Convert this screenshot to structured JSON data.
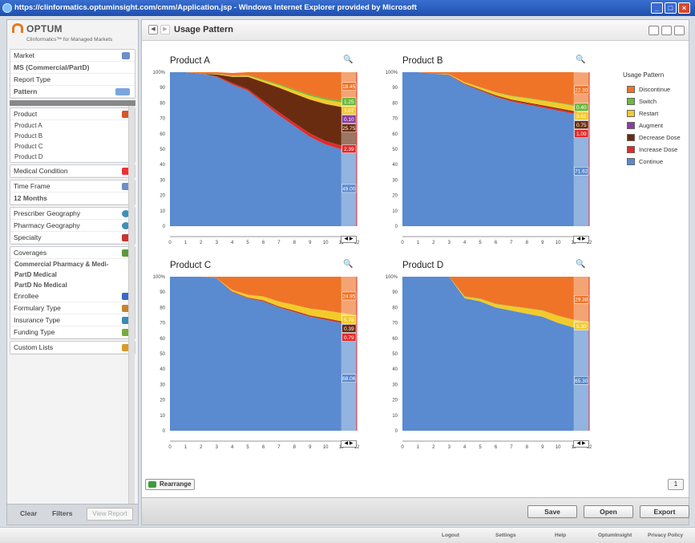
{
  "window": {
    "title": "https://clinformatics.optuminsight.com/cmm/Application.jsp - Windows Internet Explorer provided by Microsoft"
  },
  "brand": {
    "name": "OPTUM",
    "subtitle": "Clinformatics™ for Managed Markets"
  },
  "sidebar": {
    "market": {
      "label": "Market",
      "value": "MS (Commercial/PartD)"
    },
    "report_type": {
      "label": "Report Type",
      "value": "Pattern"
    },
    "product": {
      "label": "Product",
      "items": [
        "Product A",
        "Product B",
        "Product C",
        "Product D"
      ]
    },
    "medical_condition": "Medical Condition",
    "time_frame": {
      "label": "Time Frame",
      "value": "12 Months"
    },
    "prescriber_geography": "Prescriber Geography",
    "pharmacy_geography": "Pharmacy Geography",
    "specialty": "Specialty",
    "coverages": {
      "label": "Coverages",
      "items": [
        "Commercial Pharmacy & Medi-",
        "PartD Medical",
        "PartD No Medical"
      ]
    },
    "enrollee": "Enrollee",
    "formulary_type": "Formulary Type",
    "insurance_type": "Insurance Type",
    "funding_type": "Funding Type",
    "custom_lists": "Custom Lists",
    "buttons": {
      "clear": "Clear",
      "filters": "Filters",
      "view_report": "View Report"
    }
  },
  "main": {
    "title": "Usage Pattern",
    "rearrange": "Rearrange",
    "page": "1",
    "buttons": {
      "save": "Save",
      "open": "Open",
      "export": "Export"
    }
  },
  "legend": {
    "title": "Usage Pattern",
    "items": [
      "Discontinue",
      "Switch",
      "Restart",
      "Augment",
      "Decrease Dose",
      "Increase Dose",
      "Continue"
    ]
  },
  "colors": {
    "Discontinue": "#ef7428",
    "Switch": "#6cb93b",
    "Restart": "#f2cb2a",
    "Augment": "#8a3f9c",
    "Decrease Dose": "#6a2c10",
    "Increase Dose": "#e22a2a",
    "Continue": "#5a8acf"
  },
  "status": {
    "links": [
      "Logout",
      "Settings",
      "Help",
      "OptumInsight",
      "Privacy Policy"
    ]
  },
  "chart_data": [
    {
      "type": "area",
      "title": "Product A",
      "x": [
        0,
        1,
        2,
        3,
        4,
        5,
        6,
        7,
        8,
        9,
        10,
        11,
        12
      ],
      "x_ticks": [
        "0",
        "1",
        "2",
        "3",
        "4",
        "5",
        "6",
        "7",
        "8",
        "9",
        "10",
        "11",
        "12"
      ],
      "y_ticks": [
        "100%",
        "90",
        "80",
        "70",
        "60",
        "50",
        "40",
        "30",
        "20",
        "10",
        "0"
      ],
      "ylim": [
        0,
        100
      ],
      "series": [
        {
          "name": "Continue",
          "values": [
            100,
            100,
            99,
            97,
            92,
            88,
            80,
            72,
            65,
            58,
            53,
            50,
            49
          ]
        },
        {
          "name": "Increase Dose",
          "values": [
            0,
            0,
            0,
            0.5,
            1,
            1,
            1.5,
            2,
            2,
            2.2,
            2.3,
            2.4,
            2.39
          ]
        },
        {
          "name": "Decrease Dose",
          "values": [
            0,
            0,
            0,
            1,
            4,
            8,
            12,
            16,
            19,
            22,
            24,
            25,
            25.75
          ]
        },
        {
          "name": "Augment",
          "values": [
            0,
            0,
            0,
            0,
            0,
            0,
            0,
            0,
            0,
            0.05,
            0.1,
            0.1,
            0.1
          ]
        },
        {
          "name": "Restart",
          "values": [
            0,
            0,
            0,
            0.2,
            0.5,
            0.8,
            1.2,
            1.6,
            2,
            2.4,
            2.7,
            2.9,
            3.07
          ]
        },
        {
          "name": "Switch",
          "values": [
            0,
            0,
            0,
            0.2,
            0.3,
            0.4,
            0.5,
            0.7,
            0.8,
            0.9,
            1,
            1.1,
            1.25
          ]
        },
        {
          "name": "Discontinue",
          "values": [
            0,
            0,
            1,
            1.1,
            1.7,
            1.8,
            4.8,
            7.7,
            11.2,
            14.45,
            16.9,
            18.5,
            18.45
          ]
        }
      ],
      "end_labels": [
        "18.45",
        "1.25",
        "3.07",
        "0.10",
        "25.75",
        "2.39",
        "49.00"
      ]
    },
    {
      "type": "area",
      "title": "Product B",
      "x": [
        0,
        1,
        2,
        3,
        4,
        5,
        6,
        7,
        8,
        9,
        10,
        11,
        12
      ],
      "x_ticks": [
        "0",
        "1",
        "2",
        "3",
        "4",
        "5",
        "6",
        "7",
        "8",
        "9",
        "10",
        "11",
        "12"
      ],
      "y_ticks": [
        "100%",
        "90",
        "80",
        "70",
        "60",
        "50",
        "40",
        "30",
        "20",
        "10",
        "0"
      ],
      "ylim": [
        0,
        100
      ],
      "series": [
        {
          "name": "Continue",
          "values": [
            100,
            100,
            99,
            98,
            92,
            88,
            84,
            81,
            79,
            77,
            75,
            73,
            71.62
          ]
        },
        {
          "name": "Increase Dose",
          "values": [
            0,
            0,
            0,
            0.2,
            0.4,
            0.5,
            0.6,
            0.7,
            0.8,
            0.9,
            1,
            1.05,
            1.09
          ]
        },
        {
          "name": "Decrease Dose",
          "values": [
            0,
            0,
            0,
            0.1,
            0.2,
            0.3,
            0.4,
            0.5,
            0.55,
            0.6,
            0.65,
            0.7,
            0.75
          ]
        },
        {
          "name": "Augment",
          "values": [
            0,
            0,
            0,
            0,
            0,
            0,
            0,
            0,
            0,
            0,
            0,
            0,
            0
          ]
        },
        {
          "name": "Restart",
          "values": [
            0,
            0,
            0,
            0.3,
            0.8,
            1.3,
            1.8,
            2.3,
            2.7,
            3,
            3.3,
            3.5,
            3.61
          ]
        },
        {
          "name": "Switch",
          "values": [
            0,
            0,
            0,
            0.1,
            0.1,
            0.2,
            0.2,
            0.3,
            0.3,
            0.3,
            0.4,
            0.4,
            0.4
          ]
        },
        {
          "name": "Discontinue",
          "values": [
            0,
            0,
            1,
            1.3,
            6.5,
            9.7,
            13,
            15.2,
            16.65,
            18.2,
            19.65,
            21.35,
            22.3
          ]
        }
      ],
      "end_labels": [
        "22.30",
        "0.40",
        "3.61",
        "0.75",
        "1.09",
        "71.62"
      ]
    },
    {
      "type": "area",
      "title": "Product C",
      "x": [
        0,
        1,
        2,
        3,
        4,
        5,
        6,
        7,
        8,
        9,
        10,
        11,
        12
      ],
      "x_ticks": [
        "0",
        "1",
        "2",
        "3",
        "4",
        "5",
        "6",
        "7",
        "8",
        "9",
        "10",
        "11",
        "12"
      ],
      "y_ticks": [
        "100%",
        "90",
        "80",
        "70",
        "60",
        "50",
        "40",
        "30",
        "20",
        "10",
        "0"
      ],
      "ylim": [
        0,
        100
      ],
      "series": [
        {
          "name": "Continue",
          "values": [
            100,
            100,
            100,
            99,
            90,
            86,
            84,
            80,
            77,
            74,
            72,
            70,
            68.06
          ]
        },
        {
          "name": "Increase Dose",
          "values": [
            0,
            0,
            0,
            0,
            0.3,
            0.4,
            0.5,
            0.5,
            0.6,
            0.6,
            0.7,
            0.75,
            0.79
          ]
        },
        {
          "name": "Decrease Dose",
          "values": [
            0,
            0,
            0,
            0,
            0.1,
            0.15,
            0.2,
            0.25,
            0.3,
            0.3,
            0.35,
            0.37,
            0.39
          ]
        },
        {
          "name": "Augment",
          "values": [
            0,
            0,
            0,
            0,
            0,
            0,
            0,
            0,
            0,
            0,
            0,
            0,
            0
          ]
        },
        {
          "name": "Restart",
          "values": [
            0,
            0,
            0,
            0,
            1,
            1.8,
            2.5,
            3.2,
            3.8,
            4.4,
            5,
            5.4,
            5.78
          ]
        },
        {
          "name": "Switch",
          "values": [
            0,
            0,
            0,
            0,
            0,
            0,
            0,
            0,
            0,
            0,
            0,
            0,
            0
          ]
        },
        {
          "name": "Discontinue",
          "values": [
            0,
            0,
            0,
            1,
            8.6,
            11.65,
            12.8,
            16.05,
            18.3,
            20.7,
            21.95,
            23.48,
            24.98
          ]
        }
      ],
      "end_labels": [
        "24.95",
        "5.78",
        "0.39",
        "0.79",
        "68.06"
      ]
    },
    {
      "type": "area",
      "title": "Product D",
      "x": [
        0,
        1,
        2,
        3,
        4,
        5,
        6,
        7,
        8,
        9,
        10,
        11,
        12
      ],
      "x_ticks": [
        "0",
        "1",
        "2",
        "3",
        "4",
        "5",
        "6",
        "7",
        "8",
        "9",
        "10",
        "11",
        "12"
      ],
      "y_ticks": [
        "100%",
        "90",
        "80",
        "70",
        "60",
        "50",
        "40",
        "30",
        "20",
        "10",
        "0"
      ],
      "ylim": [
        0,
        100
      ],
      "series": [
        {
          "name": "Continue",
          "values": [
            100,
            100,
            100,
            100,
            86,
            84,
            80,
            78,
            76,
            74,
            70,
            67,
            65.3
          ]
        },
        {
          "name": "Increase Dose",
          "values": [
            0,
            0,
            0,
            0,
            0,
            0,
            0,
            0,
            0,
            0,
            0,
            0,
            0
          ]
        },
        {
          "name": "Decrease Dose",
          "values": [
            0,
            0,
            0,
            0,
            0,
            0,
            0,
            0,
            0,
            0,
            0,
            0,
            0
          ]
        },
        {
          "name": "Augment",
          "values": [
            0,
            0,
            0,
            0,
            0,
            0,
            0,
            0,
            0,
            0,
            0,
            0,
            0
          ]
        },
        {
          "name": "Restart",
          "values": [
            0,
            0,
            0,
            0,
            1,
            1.6,
            2.2,
            2.8,
            3.4,
            4,
            4.6,
            5,
            5.3
          ]
        },
        {
          "name": "Switch",
          "values": [
            0,
            0,
            0,
            0,
            0.3,
            0.3,
            0.3,
            0.2,
            0.2,
            0.2,
            0.1,
            0.1,
            0
          ]
        },
        {
          "name": "Discontinue",
          "values": [
            0,
            0,
            0,
            0,
            12.7,
            14.1,
            17.5,
            19,
            20.4,
            21.8,
            25.3,
            27.9,
            29.38
          ]
        }
      ],
      "end_labels": [
        "29.38",
        "5.30",
        "65.30"
      ]
    }
  ]
}
